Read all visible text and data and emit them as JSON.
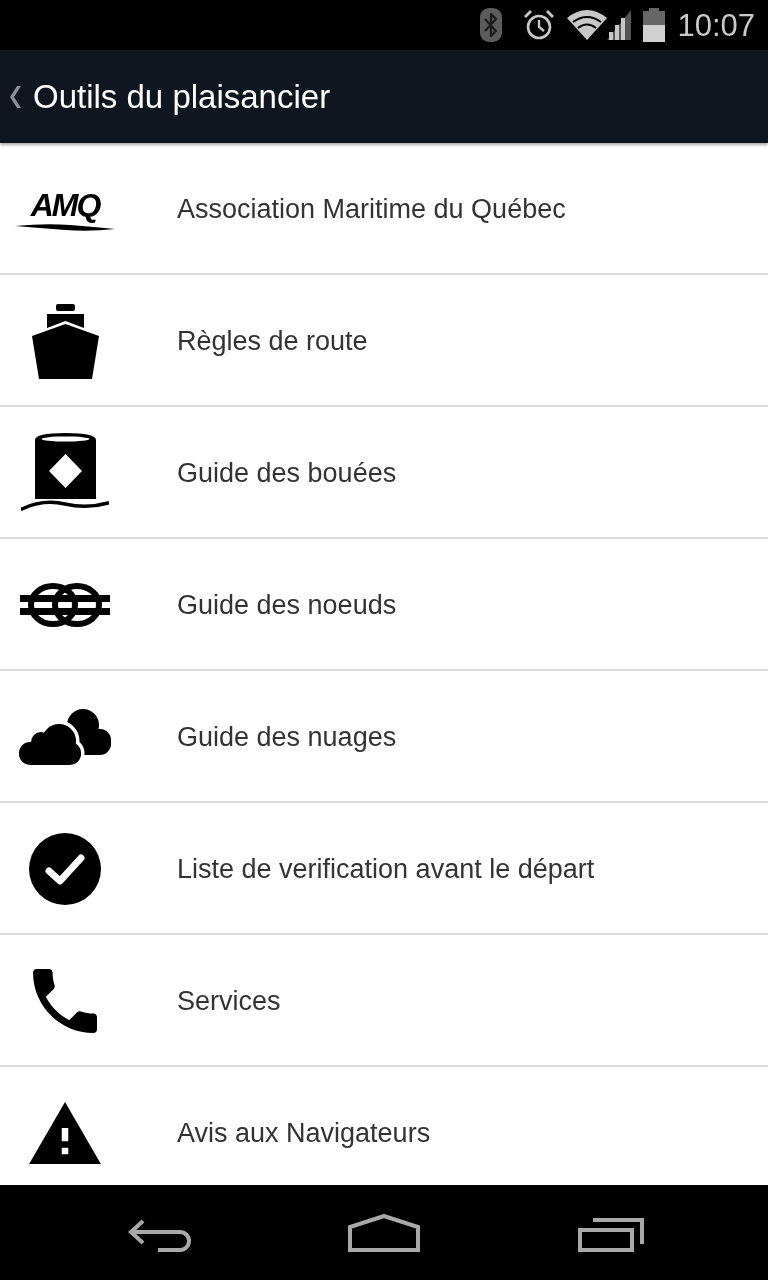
{
  "status_bar": {
    "time": "10:07"
  },
  "action_bar": {
    "title": "Outils du plaisancier"
  },
  "menu": [
    {
      "kind": "logo",
      "logo_text": "AMQ",
      "label": "Association Maritime du Québec"
    },
    {
      "kind": "icon",
      "label": "Règles de route"
    },
    {
      "kind": "icon",
      "label": "Guide des bouées"
    },
    {
      "kind": "icon",
      "label": "Guide des noeuds"
    },
    {
      "kind": "icon",
      "label": "Guide des nuages"
    },
    {
      "kind": "icon",
      "label": "Liste de verification avant le départ"
    },
    {
      "kind": "icon",
      "label": "Services"
    },
    {
      "kind": "icon",
      "label": "Avis aux Navigateurs"
    }
  ]
}
